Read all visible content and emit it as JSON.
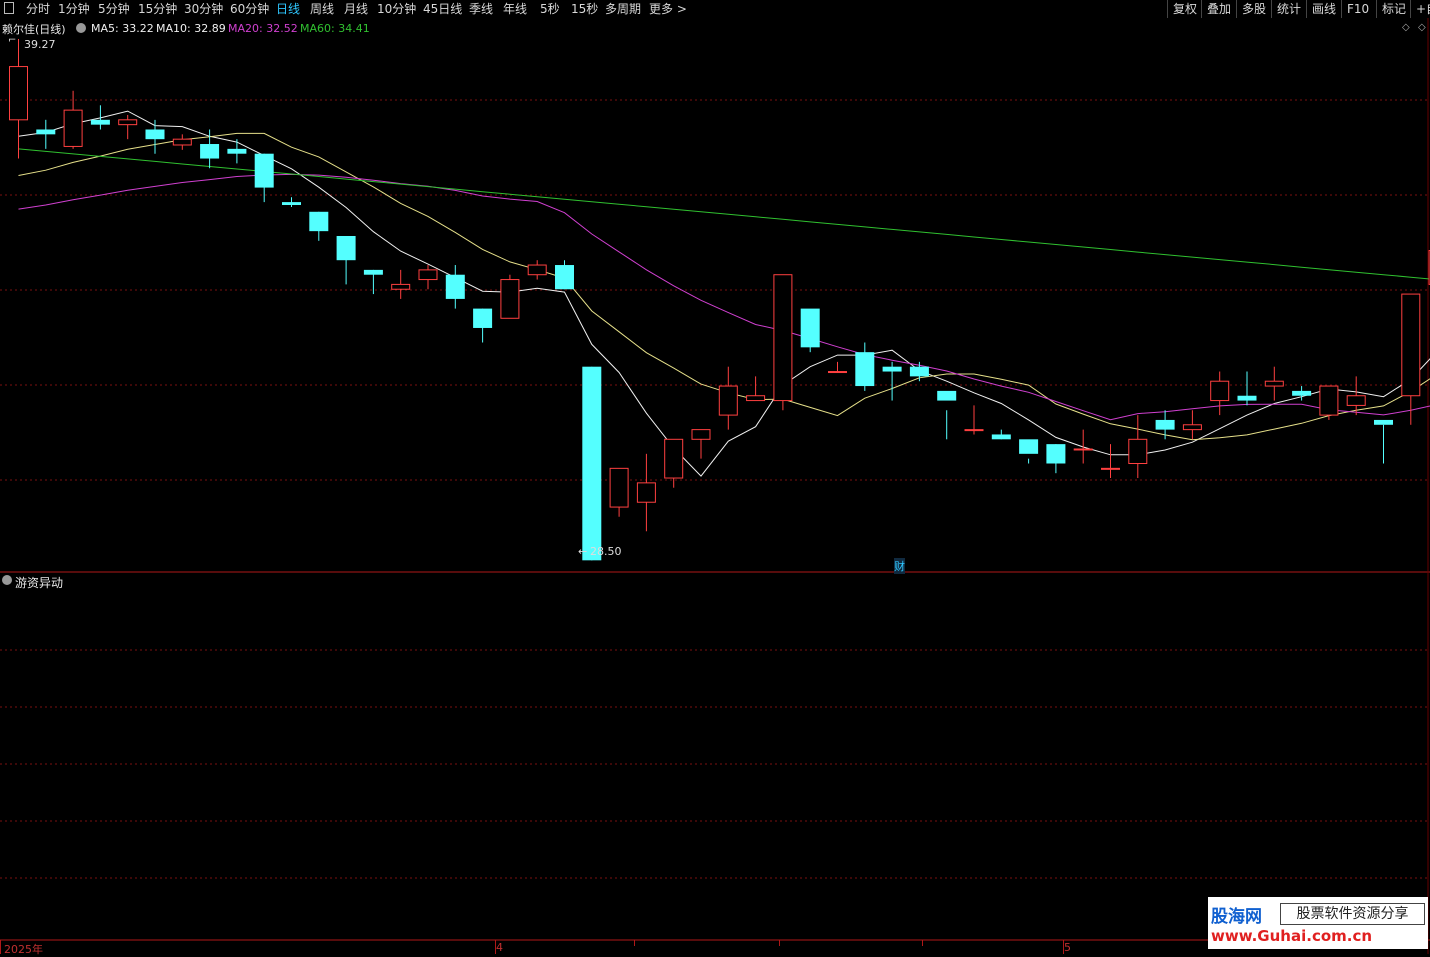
{
  "toolbar": {
    "periods": [
      "分时",
      "1分钟",
      "5分钟",
      "15分钟",
      "30分钟",
      "60分钟",
      "日线",
      "周线",
      "月线",
      "10分钟",
      "45日线",
      "季线",
      "年线",
      "5秒",
      "15秒",
      "多周期",
      "更多 >"
    ],
    "active_period": "日线",
    "right_buttons": [
      "复权",
      "叠加",
      "多股",
      "统计",
      "画线",
      "F10",
      "标记",
      "+自"
    ]
  },
  "main_panel": {
    "title": "赖尔佳(日线)",
    "ma": [
      {
        "label": "MA5: 33.22",
        "color": "#f0f0f0"
      },
      {
        "label": "MA10: 32.89",
        "color": "#f0f0f0"
      },
      {
        "label": "MA20: 32.52",
        "color": "#d040d0"
      },
      {
        "label": "MA60: 34.41",
        "color": "#30c030"
      }
    ],
    "high_label": "39.27",
    "low_label": "28.50",
    "finance_marker": "财",
    "up_color": "#ff4040",
    "down_color": "#54ffff"
  },
  "sub_panel": {
    "title": "游资异动",
    "bar_color": "#e8346e"
  },
  "x_axis": {
    "labels": [
      "2025年",
      "4",
      "5"
    ]
  },
  "watermark": {
    "brand": "股海网",
    "tagline": "股票软件资源分享",
    "url": "www.Guhai.com.cn"
  },
  "chart_data": {
    "type": "candlestick",
    "ma_periods": [
      5,
      10,
      20,
      60
    ],
    "ohlc": [
      [
        37.6,
        39.27,
        36.8,
        38.7
      ],
      [
        37.4,
        37.6,
        37.0,
        37.3
      ],
      [
        37.05,
        38.2,
        37.0,
        37.8
      ],
      [
        37.6,
        37.9,
        37.4,
        37.5
      ],
      [
        37.5,
        37.7,
        37.2,
        37.6
      ],
      [
        37.4,
        37.6,
        36.9,
        37.2
      ],
      [
        37.08,
        37.3,
        36.98,
        37.2
      ],
      [
        37.1,
        37.4,
        36.6,
        36.8
      ],
      [
        37.0,
        37.2,
        36.7,
        36.9
      ],
      [
        36.9,
        36.9,
        35.9,
        36.2
      ],
      [
        35.9,
        36.0,
        35.8,
        35.84
      ],
      [
        35.7,
        35.7,
        35.1,
        35.3
      ],
      [
        35.2,
        35.2,
        34.2,
        34.7
      ],
      [
        34.5,
        34.5,
        34.0,
        34.4
      ],
      [
        34.1,
        34.5,
        33.9,
        34.2
      ],
      [
        34.3,
        34.6,
        34.1,
        34.5
      ],
      [
        34.4,
        34.6,
        33.7,
        33.9
      ],
      [
        33.7,
        33.7,
        33.0,
        33.3
      ],
      [
        33.5,
        34.4,
        33.5,
        34.3
      ],
      [
        34.4,
        34.7,
        34.3,
        34.6
      ],
      [
        34.6,
        34.7,
        34.1,
        34.1
      ],
      [
        32.5,
        32.5,
        28.5,
        28.5
      ],
      [
        29.6,
        30.2,
        29.4,
        30.4
      ],
      [
        29.7,
        30.7,
        29.1,
        30.1
      ],
      [
        30.2,
        30.9,
        30.0,
        31.0
      ],
      [
        31.0,
        31.2,
        30.6,
        31.2
      ],
      [
        31.5,
        32.5,
        31.2,
        32.1
      ],
      [
        31.8,
        32.3,
        31.8,
        31.9
      ],
      [
        31.8,
        33.4,
        31.6,
        34.4
      ],
      [
        33.7,
        33.3,
        32.8,
        32.9
      ],
      [
        32.4,
        32.4,
        32.6,
        32.4
      ],
      [
        32.8,
        33.0,
        32.0,
        32.1
      ],
      [
        32.5,
        32.6,
        31.8,
        32.4
      ],
      [
        32.5,
        32.6,
        32.2,
        32.3
      ],
      [
        32.0,
        31.6,
        31.0,
        31.8
      ],
      [
        31.2,
        31.7,
        31.1,
        31.2
      ],
      [
        31.1,
        31.2,
        31.0,
        31.0
      ],
      [
        31.0,
        30.6,
        30.5,
        30.7
      ],
      [
        30.9,
        30.9,
        30.3,
        30.5
      ],
      [
        30.8,
        31.2,
        30.5,
        30.8
      ],
      [
        30.4,
        30.9,
        30.2,
        30.4
      ],
      [
        30.5,
        31.5,
        30.2,
        31.0
      ],
      [
        31.4,
        31.6,
        31.0,
        31.2
      ],
      [
        31.2,
        31.6,
        31.0,
        31.3
      ],
      [
        31.8,
        32.4,
        31.5,
        32.2
      ],
      [
        31.9,
        32.4,
        31.7,
        31.8
      ],
      [
        32.1,
        32.5,
        31.8,
        32.2
      ],
      [
        32.0,
        32.1,
        31.8,
        31.9
      ],
      [
        31.5,
        32.1,
        31.4,
        32.1
      ],
      [
        31.7,
        32.3,
        31.5,
        31.9
      ],
      [
        31.4,
        31.3,
        30.5,
        31.3
      ],
      [
        31.9,
        33.9,
        31.3,
        34.0
      ],
      [
        34.2,
        35.8,
        34.0,
        34.9
      ]
    ],
    "y_range": [
      28.3,
      39.6
    ],
    "sub_bar_index": 52
  }
}
